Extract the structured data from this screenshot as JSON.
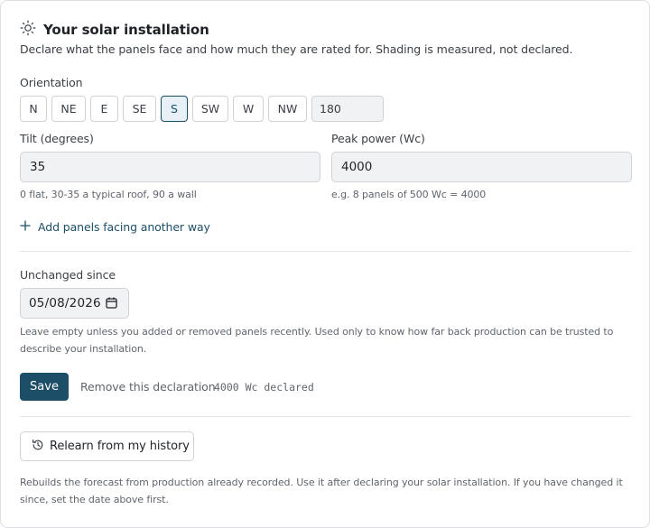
{
  "header": {
    "icon": "sun-icon",
    "title": "Your solar installation",
    "subtitle": "Declare what the panels face and how much they are rated for. Shading is measured, not declared."
  },
  "orientation": {
    "label": "Orientation",
    "options": [
      "N",
      "NE",
      "E",
      "SE",
      "S",
      "SW",
      "W",
      "NW"
    ],
    "selected": "S",
    "degrees": "180"
  },
  "tilt": {
    "label": "Tilt (degrees)",
    "value": "35",
    "hint": "0 flat, 30-35 a typical roof, 90 a wall"
  },
  "peak": {
    "label": "Peak power (Wc)",
    "value": "4000",
    "hint": "e.g. 8 panels of 500 Wc = 4000"
  },
  "add_panels": {
    "icon": "plus-icon",
    "label": "Add panels facing another way"
  },
  "unchanged": {
    "label": "Unchanged since",
    "value": "05/08/2026",
    "icon": "calendar-icon",
    "help": "Leave empty unless you added or removed panels recently. Used only to know how far back production can be trusted to describe your installation."
  },
  "actions": {
    "save_label": "Save",
    "remove_label": "Remove this declaration",
    "declared_text": "4000 Wc declared"
  },
  "relearn": {
    "icon": "history-icon",
    "label": "Relearn from my history",
    "help": "Rebuilds the forecast from production already recorded. Use it after declaring your solar installation. If you have changed it since, set the date above first."
  },
  "colors": {
    "accent": "#1d4e67",
    "selected_bg": "#e6f0f6",
    "input_bg": "#f1f2f3",
    "border": "#cfd3d8",
    "muted_text": "#5f656c"
  }
}
